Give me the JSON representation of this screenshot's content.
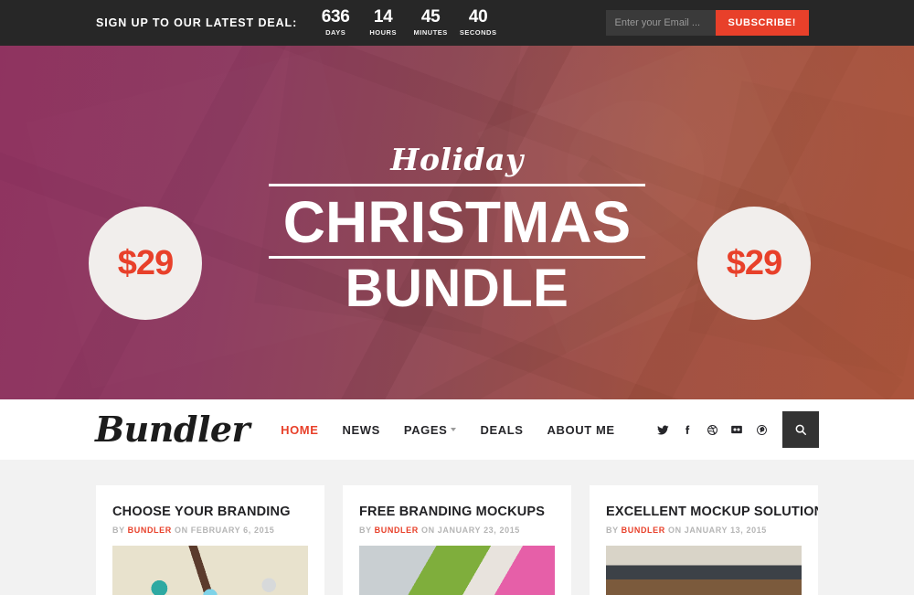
{
  "topbar": {
    "deal_label": "SIGN UP TO OUR LATEST DEAL:",
    "countdown": [
      {
        "value": "636",
        "unit": "DAYS"
      },
      {
        "value": "14",
        "unit": "HOURS"
      },
      {
        "value": "45",
        "unit": "MINUTES"
      },
      {
        "value": "40",
        "unit": "SECONDS"
      }
    ],
    "email_placeholder": "Enter your Email ...",
    "email_value": "",
    "subscribe_label": "SUBSCRIBE!",
    "accent_color": "#e8402a",
    "bar_color": "#272727"
  },
  "hero": {
    "price_left": "$29",
    "price_right": "$29",
    "script_line": "Holiday",
    "title_line_1": "CHRISTMAS",
    "title_line_2": "BUNDLE",
    "gradient_start": "#8e2f5e",
    "gradient_end": "#ab5630",
    "price_text_color": "#e8402a",
    "price_circle_color": "#f1eeec"
  },
  "nav": {
    "logo": "Bundler",
    "links": [
      {
        "label": "HOME",
        "active": true,
        "caret": false
      },
      {
        "label": "NEWS",
        "active": false,
        "caret": false
      },
      {
        "label": "PAGES",
        "active": false,
        "caret": true
      },
      {
        "label": "DEALS",
        "active": false,
        "caret": false
      },
      {
        "label": "ABOUT ME",
        "active": false,
        "caret": false
      }
    ],
    "social": [
      {
        "name": "twitter-icon"
      },
      {
        "name": "facebook-icon"
      },
      {
        "name": "dribbble-icon"
      },
      {
        "name": "flickr-icon"
      },
      {
        "name": "pinterest-icon"
      }
    ],
    "search_icon": "search-icon",
    "active_color": "#e8402a"
  },
  "posts": [
    {
      "title": "CHOOSE YOUR BRANDING",
      "by": "BY",
      "author": "BUNDLER",
      "on_date": "ON FEBRUARY 6, 2015"
    },
    {
      "title": "FREE BRANDING MOCKUPS",
      "by": "BY",
      "author": "BUNDLER",
      "on_date": "ON JANUARY 23, 2015"
    },
    {
      "title": "EXCELLENT MOCKUP SOLUTIONS",
      "by": "BY",
      "author": "BUNDLER",
      "on_date": "ON JANUARY 13, 2015"
    }
  ]
}
